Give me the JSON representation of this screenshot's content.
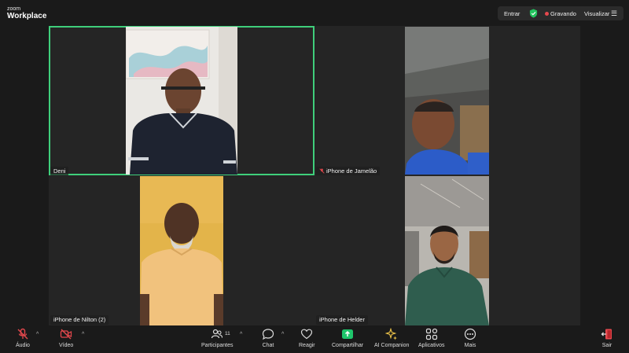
{
  "app": {
    "brand_small": "zoom",
    "brand_name": "Workplace"
  },
  "top_controls": {
    "enter_label": "Entrar",
    "recording_label": "Gravando",
    "view_label": "Visualizar",
    "shield_icon": "shield-check-icon",
    "menu_icon": "hamburger-menu-icon",
    "accent": "#3fcf7b",
    "recording_color": "#e5484d"
  },
  "participants": [
    {
      "name": "Deni",
      "muted": false,
      "active_speaker": true
    },
    {
      "name": "iPhone de Jamelão",
      "muted": true,
      "active_speaker": false
    },
    {
      "name": "iPhone de Nilton (2)",
      "muted": false,
      "active_speaker": false
    },
    {
      "name": "iPhone de Helder",
      "muted": false,
      "active_speaker": false
    }
  ],
  "toolbar": {
    "audio_label": "Áudio",
    "video_label": "Vídeo",
    "participants_label": "Participantes",
    "participants_count": "11",
    "chat_label": "Chat",
    "react_label": "Reagir",
    "share_label": "Compartilhar",
    "companion_label": "AI Companion",
    "apps_label": "Aplicativos",
    "more_label": "Mais",
    "leave_label": "Sair",
    "share_color": "#1ec66b",
    "leave_color": "#e5484d",
    "mute_color": "#e5484d"
  }
}
